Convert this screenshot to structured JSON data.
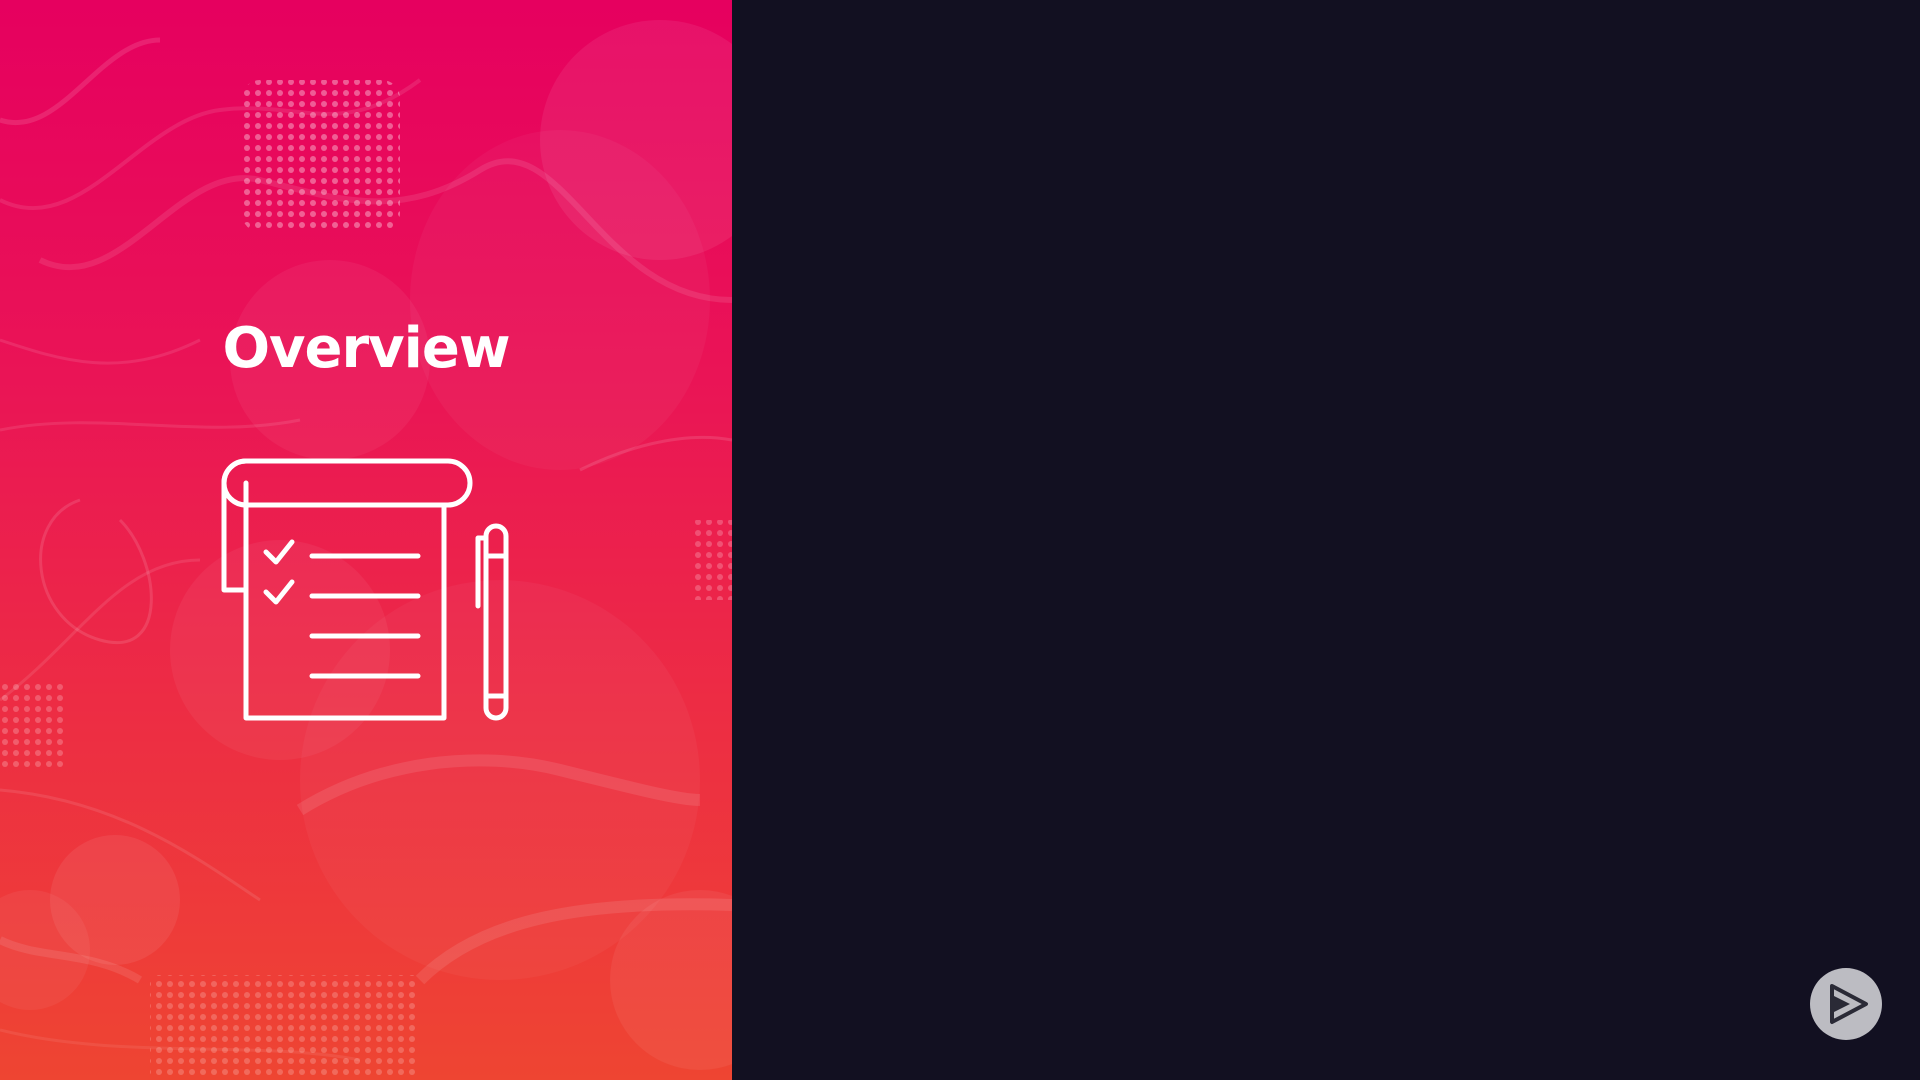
{
  "slide": {
    "title": "Overview"
  },
  "icons": {
    "main": "checklist-notepad-pen-icon",
    "corner": "play-logo-icon"
  },
  "colors": {
    "panel_top": "#e6005f",
    "panel_bottom": "#ee4532",
    "background": "#121021",
    "foreground": "#ffffff",
    "logo": "#bcbcc2"
  }
}
